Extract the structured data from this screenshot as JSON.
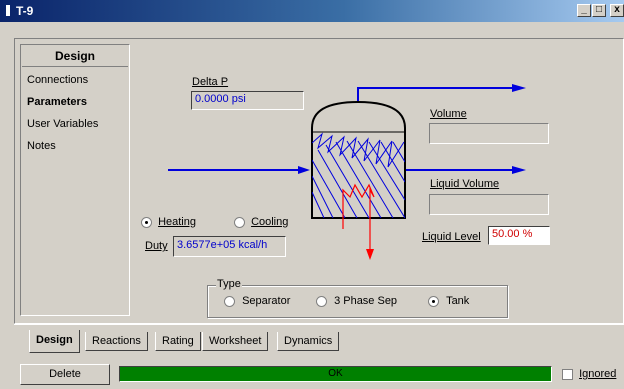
{
  "window": {
    "title": "T-9",
    "buttons": {
      "minimize": "_",
      "maximize": "□",
      "close": "x"
    }
  },
  "nav": {
    "header": "Design",
    "items": [
      {
        "label": "Connections"
      },
      {
        "label": "Parameters"
      },
      {
        "label": "User Variables"
      },
      {
        "label": "Notes"
      }
    ]
  },
  "params": {
    "delta_p_label": "Delta P",
    "delta_p_value": "0.0000 psi",
    "volume_label": "Volume",
    "volume_value": "",
    "liquid_volume_label": "Liquid Volume",
    "liquid_volume_value": "",
    "liquid_level_label": "Liquid Level",
    "liquid_level_value": "50.00 %",
    "heating_label": "Heating",
    "cooling_label": "Cooling",
    "duty_label": "Duty",
    "duty_value": "3.6577e+05 kcal/h"
  },
  "type_group": {
    "label": "Type",
    "options": [
      {
        "label": "Separator",
        "selected": false
      },
      {
        "label": "3 Phase Sep",
        "selected": false
      },
      {
        "label": "Tank",
        "selected": true
      }
    ]
  },
  "tabs": [
    {
      "label": "Design",
      "active": true
    },
    {
      "label": "Reactions",
      "active": false
    },
    {
      "label": "Rating",
      "active": false
    },
    {
      "label": "Worksheet",
      "active": false
    },
    {
      "label": "Dynamics",
      "active": false
    }
  ],
  "footer": {
    "delete_label": "Delete",
    "status_text": "OK",
    "ignored_label": "Ignored"
  },
  "colors": {
    "stream": "#0000dd",
    "energy": "#ff0000",
    "status_ok": "#008000",
    "title_bar": "#0a246a"
  }
}
